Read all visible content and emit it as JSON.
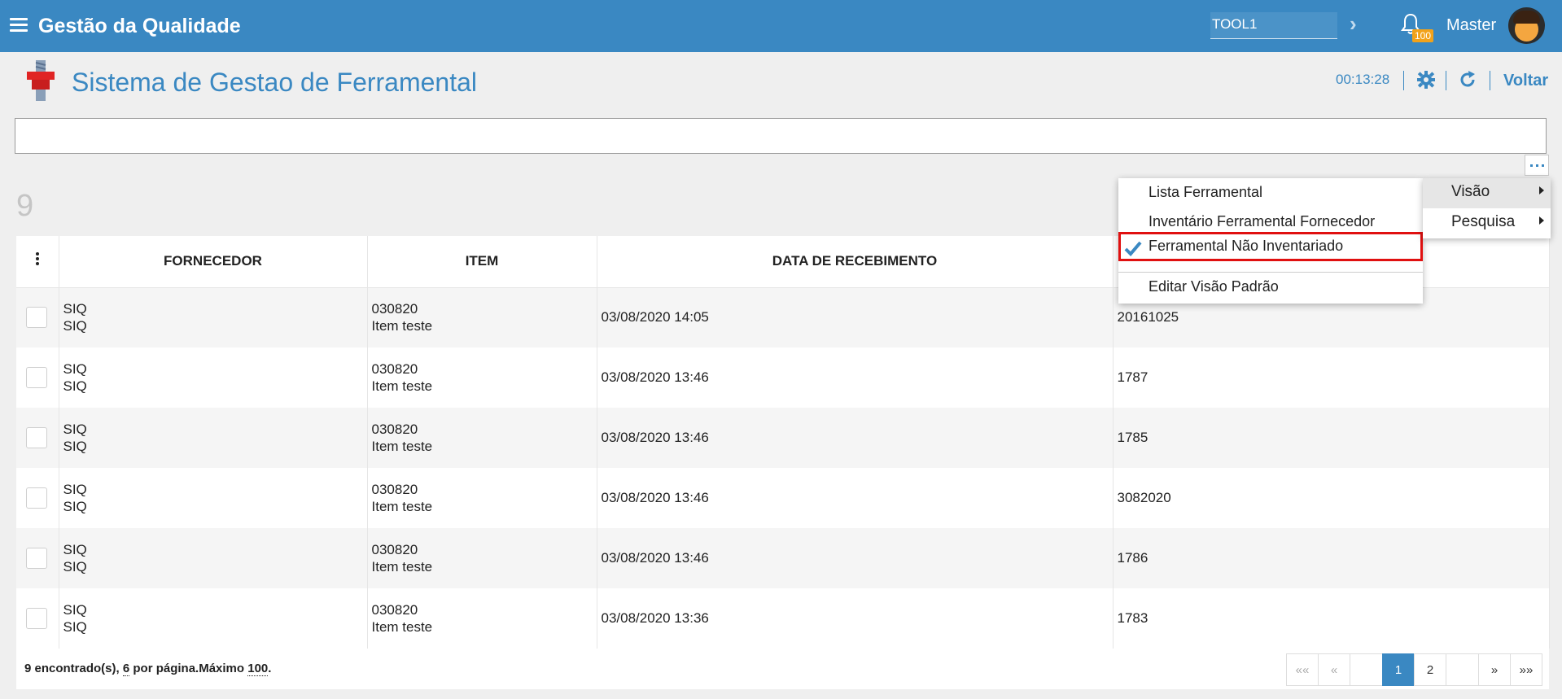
{
  "topbar": {
    "title": "Gestão da Qualidade",
    "tool_value": "TOOL1",
    "notification_count": "100",
    "user": "Master"
  },
  "header": {
    "title": "Sistema de Gestao de Ferramental",
    "timer": "00:13:28",
    "back_label": "Voltar"
  },
  "search": {
    "value": ""
  },
  "result_count": "9",
  "table": {
    "headers": [
      "FORNECEDOR",
      "ITEM",
      "DATA DE RECEBIMENTO"
    ],
    "rows": [
      {
        "fornecedor1": "SIQ",
        "fornecedor2": "SIQ",
        "item1": "030820",
        "item2": "Item teste",
        "data": "03/08/2020 14:05",
        "extra": "20161025"
      },
      {
        "fornecedor1": "SIQ",
        "fornecedor2": "SIQ",
        "item1": "030820",
        "item2": "Item teste",
        "data": "03/08/2020 13:46",
        "extra": "1787"
      },
      {
        "fornecedor1": "SIQ",
        "fornecedor2": "SIQ",
        "item1": "030820",
        "item2": "Item teste",
        "data": "03/08/2020 13:46",
        "extra": "1785"
      },
      {
        "fornecedor1": "SIQ",
        "fornecedor2": "SIQ",
        "item1": "030820",
        "item2": "Item teste",
        "data": "03/08/2020 13:46",
        "extra": "3082020"
      },
      {
        "fornecedor1": "SIQ",
        "fornecedor2": "SIQ",
        "item1": "030820",
        "item2": "Item teste",
        "data": "03/08/2020 13:46",
        "extra": "1786"
      },
      {
        "fornecedor1": "SIQ",
        "fornecedor2": "SIQ",
        "item1": "030820",
        "item2": "Item teste",
        "data": "03/08/2020 13:36",
        "extra": "1783"
      }
    ]
  },
  "footer": {
    "found_text": "9 encontrado(s), ",
    "per_page": "6",
    "per_page_text": " por página.Máximo ",
    "max": "100",
    "end": "."
  },
  "pagination": {
    "first": "««",
    "prev": "«",
    "pages": [
      "1",
      "2"
    ],
    "current": "1",
    "next": "»",
    "last": "»»"
  },
  "views_menu": {
    "items": [
      "Lista Ferramental",
      "Inventário Ferramental Fornecedor",
      "Ferramental Não Inventariado",
      "Editar Visão Padrão"
    ],
    "selected": "Ferramental Não Inventariado"
  },
  "options_menu": {
    "items": [
      "Visão",
      "Pesquisa"
    ]
  },
  "colors": {
    "primary": "#3a88c2",
    "badge": "#f2a21a",
    "highlight_border": "#e01010"
  }
}
